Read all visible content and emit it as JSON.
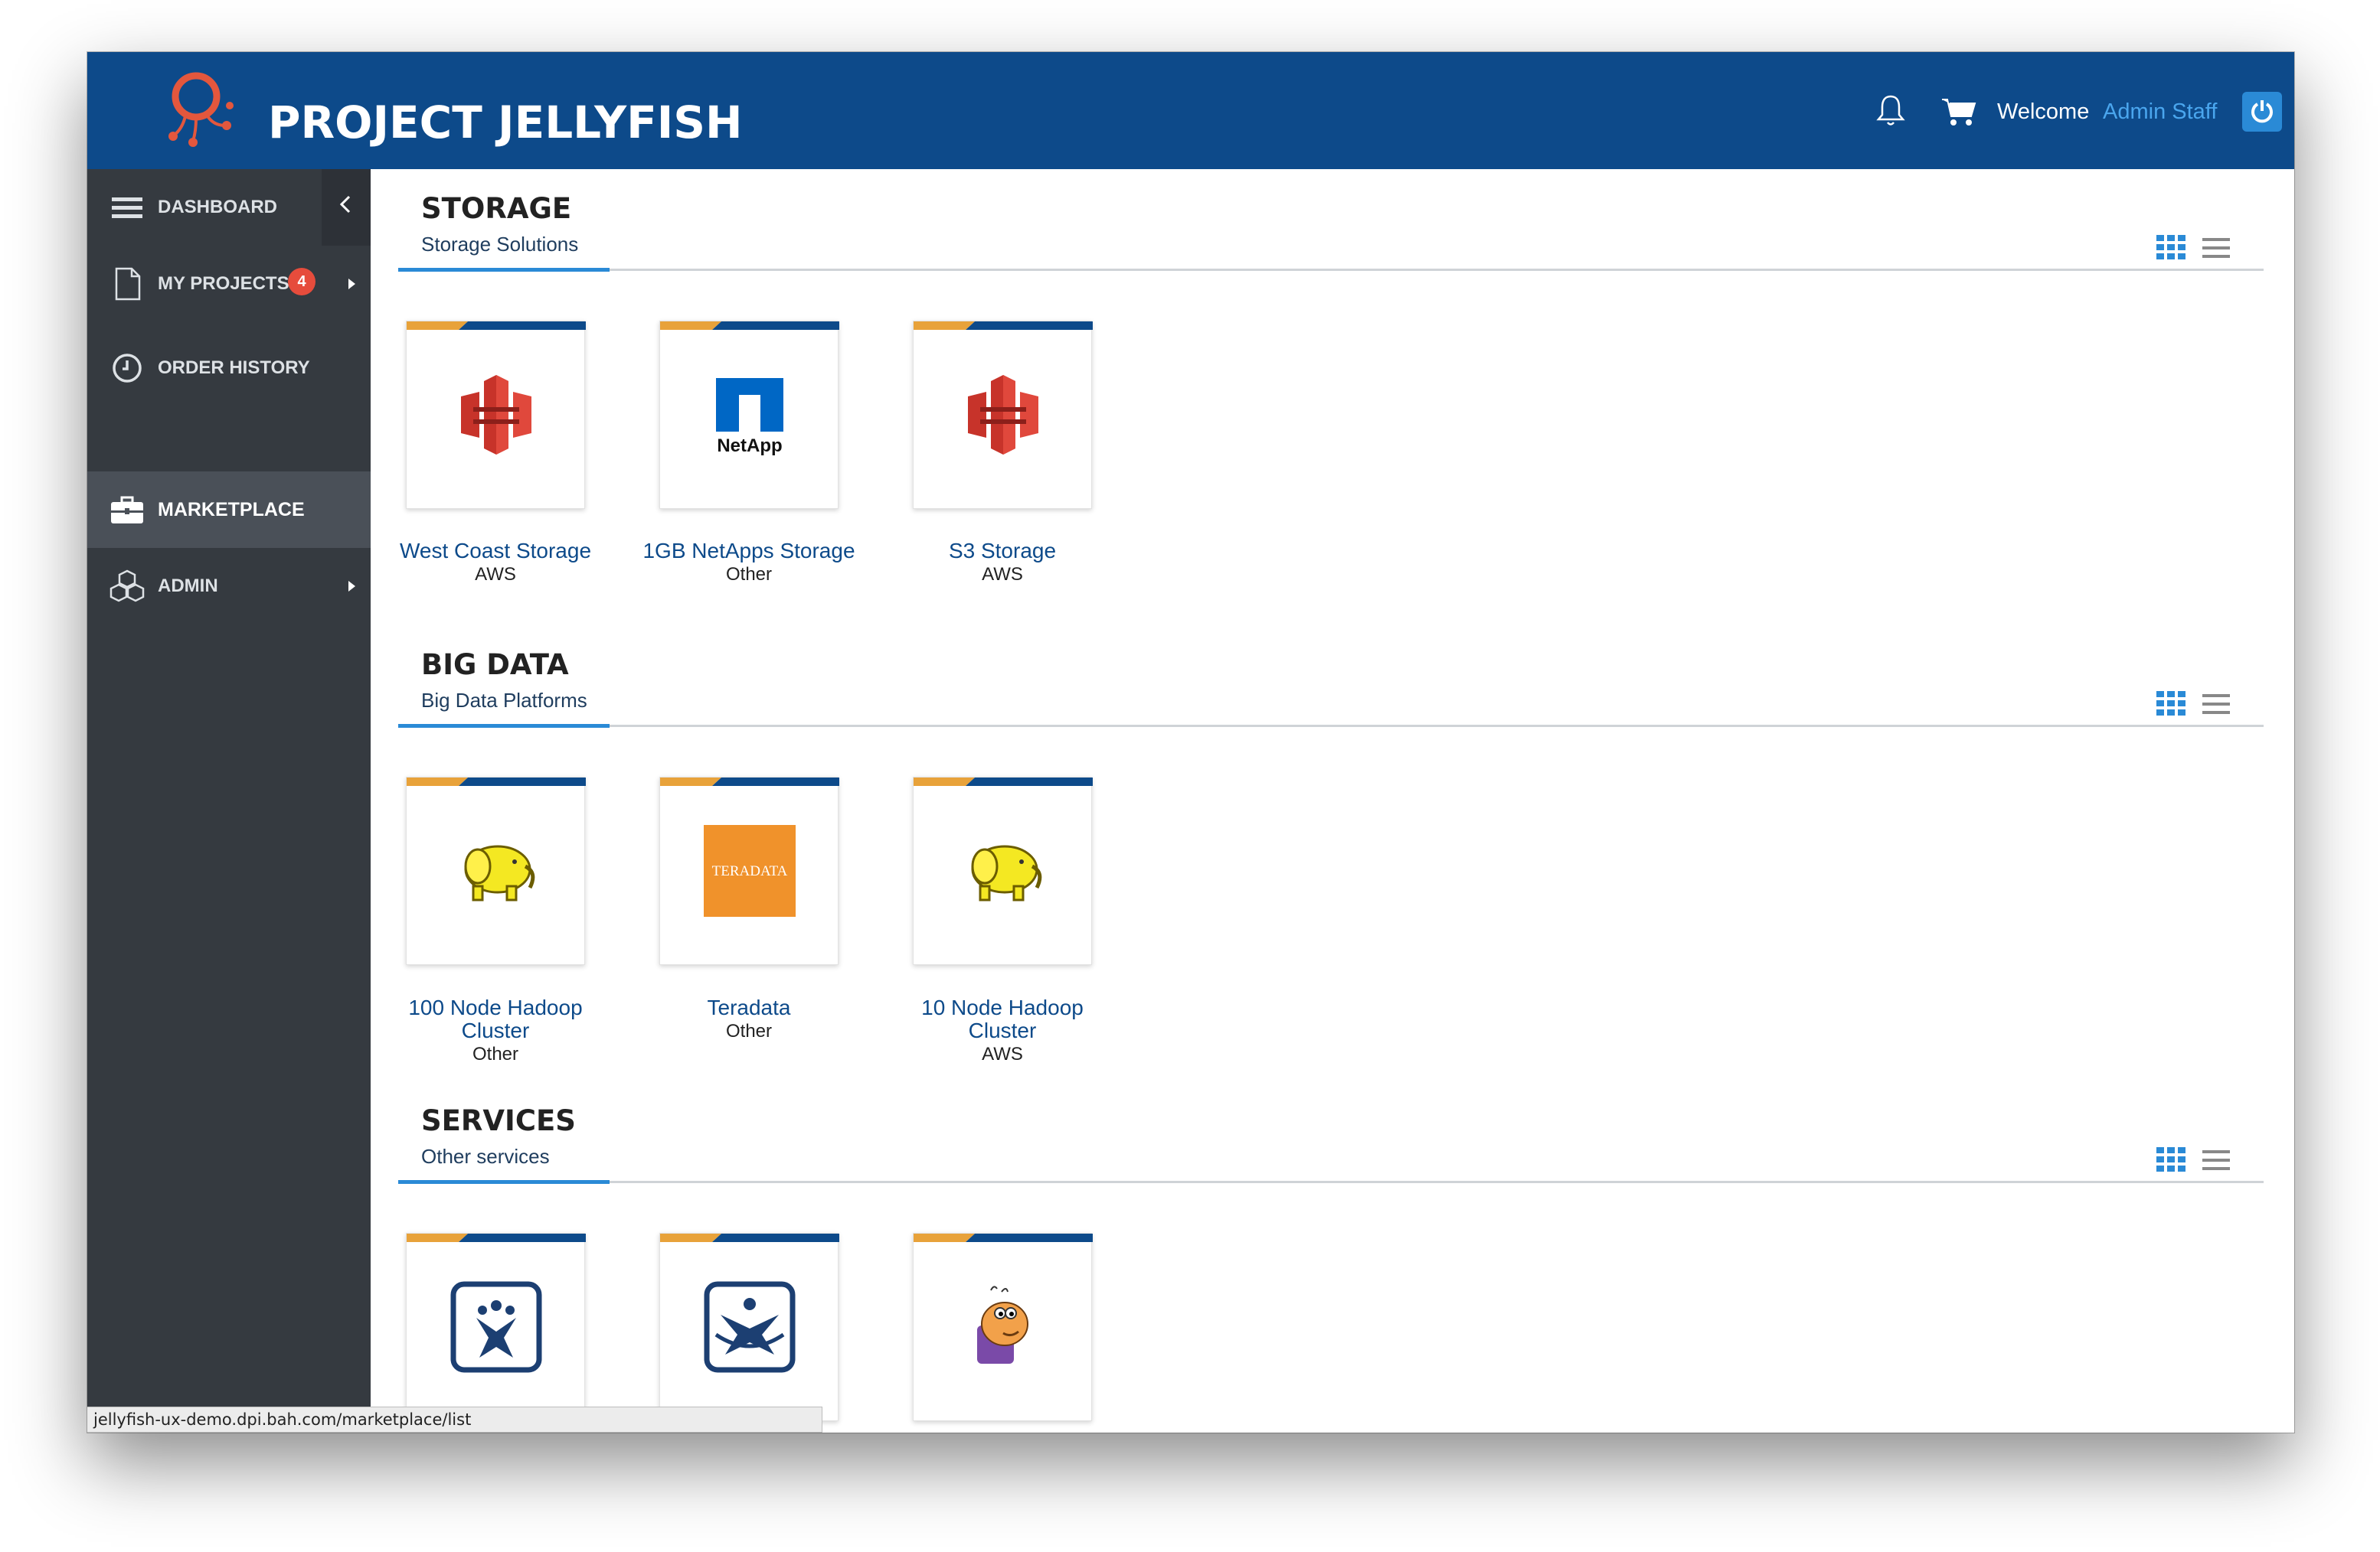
{
  "header": {
    "brand": "PROJECT JELLYFISH",
    "welcome": "Welcome",
    "user_name": "Admin Staff",
    "brand_color": "#0d4a8a"
  },
  "sidebar": {
    "items": [
      {
        "label": "DASHBOARD",
        "icon": "menu-icon"
      },
      {
        "label": "MY PROJECTS",
        "icon": "document-icon",
        "badge": "4"
      },
      {
        "label": "ORDER HISTORY",
        "icon": "clock-icon"
      },
      {
        "label": "MARKETPLACE",
        "icon": "briefcase-icon",
        "active": true
      },
      {
        "label": "ADMIN",
        "icon": "cubes-icon"
      }
    ]
  },
  "sections": [
    {
      "title": "STORAGE",
      "subtitle": "Storage Solutions",
      "items": [
        {
          "name": "West Coast Storage",
          "provider": "AWS",
          "icon": "aws-s3-icon"
        },
        {
          "name": "1GB NetApps Storage",
          "provider": "Other",
          "icon": "netapp-logo",
          "logo_text": "NetApp"
        },
        {
          "name": "S3 Storage",
          "provider": "AWS",
          "icon": "aws-s3-icon"
        }
      ]
    },
    {
      "title": "BIG DATA",
      "subtitle": "Big Data Platforms",
      "items": [
        {
          "name_line1": "100 Node Hadoop",
          "name_line2": "Cluster",
          "provider": "Other",
          "icon": "hadoop-elephant-icon"
        },
        {
          "name": "Teradata",
          "provider": "Other",
          "icon": "teradata-logo",
          "logo_text": "TERADATA"
        },
        {
          "name_line1": "10 Node Hadoop",
          "name_line2": "Cluster",
          "provider": "AWS",
          "icon": "hadoop-elephant-icon"
        }
      ]
    },
    {
      "title": "SERVICES",
      "subtitle": "Other services",
      "items": [
        {
          "icon": "jira-logo"
        },
        {
          "icon": "confluence-logo"
        },
        {
          "icon": "ant-mascot-icon"
        }
      ]
    }
  ],
  "status_bar": {
    "url": "jellyfish-ux-demo.dpi.bah.com/marketplace/list"
  },
  "colors": {
    "accent_blue": "#2a8ad6",
    "accent_orange": "#e8a23a",
    "sidebar_bg": "#353a40",
    "badge_red": "#e64c3c"
  }
}
